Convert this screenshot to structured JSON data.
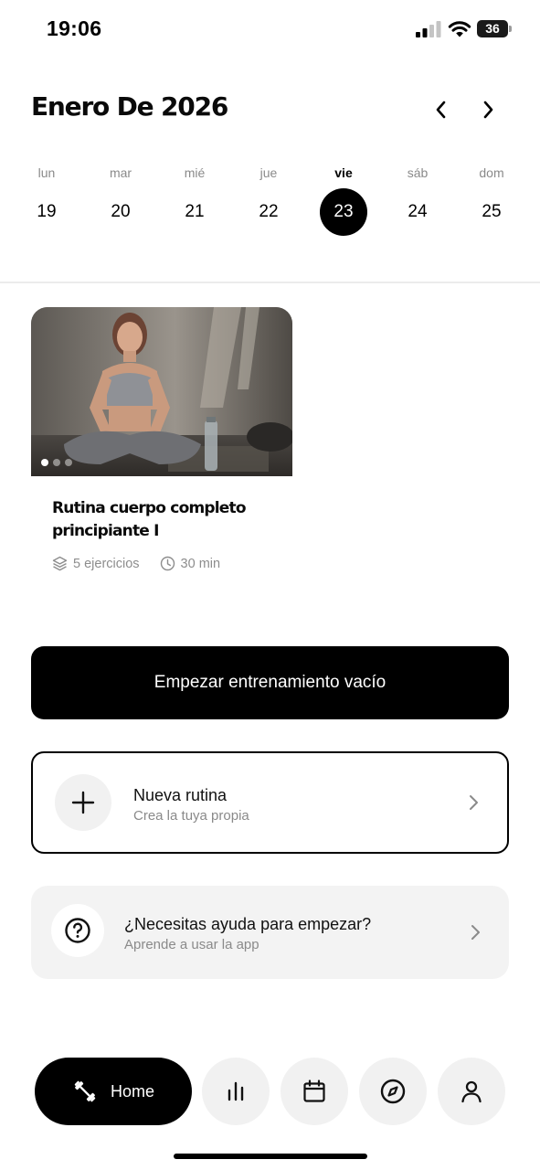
{
  "status_bar": {
    "time": "19:06",
    "battery": "36"
  },
  "header": {
    "month_title": "Enero De 2026",
    "prev_icon": "chevron-left-icon",
    "next_icon": "chevron-right-icon"
  },
  "week": {
    "days": [
      {
        "name": "lun",
        "num": "19"
      },
      {
        "name": "mar",
        "num": "20"
      },
      {
        "name": "mié",
        "num": "21"
      },
      {
        "name": "jue",
        "num": "22"
      },
      {
        "name": "vie",
        "num": "23"
      },
      {
        "name": "sáb",
        "num": "24"
      },
      {
        "name": "dom",
        "num": "25"
      }
    ],
    "selected": "23"
  },
  "routine": {
    "title": "Rutina cuerpo completo principiante I",
    "exercises": "5 ejercicios",
    "duration": "30 min",
    "exercises_icon": "layers-icon",
    "duration_icon": "clock-icon",
    "image_pages": 3,
    "image_page_active": 1
  },
  "actions": {
    "start_empty": "Empezar entrenamiento vacío",
    "new_routine_title": "Nueva rutina",
    "new_routine_sub": "Crea la tuya propia",
    "new_routine_icon": "plus-icon",
    "help_title": "¿Necesitas ayuda para empezar?",
    "help_sub": "Aprende a usar la app",
    "help_icon": "question-circle-icon"
  },
  "bottom_nav": {
    "home_label": "Home",
    "items": [
      "dumbbell-icon",
      "bar-chart-icon",
      "calendar-icon",
      "compass-icon",
      "user-icon"
    ]
  },
  "colors": {
    "primary": "#000000",
    "surface": "#f3f3f3",
    "muted_text": "#8a8a8a"
  }
}
